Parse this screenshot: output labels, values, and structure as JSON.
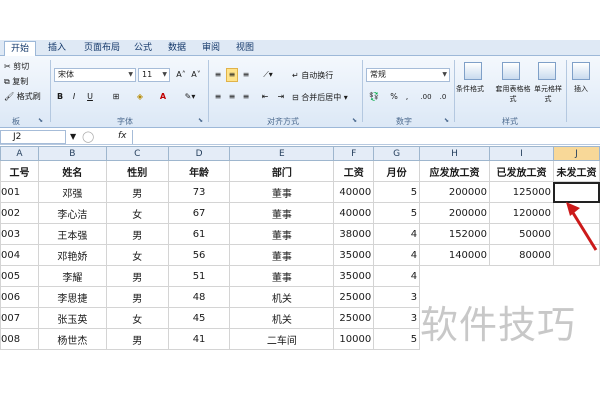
{
  "ribbon": {
    "tabs": [
      "开始",
      "插入",
      "页面布局",
      "公式",
      "数据",
      "审阅",
      "视图"
    ],
    "clipboard": {
      "cut": "剪切",
      "copy": "复制",
      "format_painter": "格式刷",
      "label": "板"
    },
    "font": {
      "name": "宋体",
      "size": "11",
      "grow": "A˄",
      "shrink": "A˅",
      "bold": "B",
      "italic": "I",
      "underline": "U",
      "label": "字体"
    },
    "alignment": {
      "wrap": "自动换行",
      "merge": "合并后居中",
      "label": "对齐方式"
    },
    "number": {
      "format": "常规",
      "label": "数字"
    },
    "styles": {
      "conditional": "条件格式",
      "as_table": "套用表格格式",
      "cell_styles": "单元格样式",
      "label": "样式"
    },
    "cells": {
      "insert": "插入"
    }
  },
  "formula_bar": {
    "name_box": "J2",
    "fx": "fx"
  },
  "columns": [
    "A",
    "B",
    "C",
    "D",
    "E",
    "F",
    "G",
    "H",
    "I",
    "J"
  ],
  "headers": [
    "工号",
    "姓名",
    "性别",
    "年龄",
    "部门",
    "工资",
    "月份",
    "应发放工资",
    "已发放工资",
    "未发工资"
  ],
  "rows": [
    [
      "001",
      "邓强",
      "男",
      "73",
      "董事",
      "40000",
      "5",
      "200000",
      "125000",
      ""
    ],
    [
      "002",
      "李心洁",
      "女",
      "67",
      "董事",
      "40000",
      "5",
      "200000",
      "120000",
      ""
    ],
    [
      "003",
      "王本强",
      "男",
      "61",
      "董事",
      "38000",
      "4",
      "152000",
      "50000",
      ""
    ],
    [
      "004",
      "邓艳娇",
      "女",
      "56",
      "董事",
      "35000",
      "4",
      "140000",
      "80000",
      ""
    ],
    [
      "005",
      "李耀",
      "男",
      "51",
      "董事",
      "35000",
      "4",
      "",
      "",
      ""
    ],
    [
      "006",
      "李思捷",
      "男",
      "48",
      "机关",
      "25000",
      "3",
      "",
      "",
      ""
    ],
    [
      "007",
      "张玉英",
      "女",
      "45",
      "机关",
      "25000",
      "3",
      "",
      "",
      ""
    ],
    [
      "008",
      "杨世杰",
      "男",
      "41",
      "二车间",
      "10000",
      "5",
      "",
      "",
      ""
    ]
  ],
  "watermark": "软件技巧",
  "colors": {
    "ribbon": "#dce8f6",
    "selection_header": "#f8d898",
    "arrow": "#cc1a1a"
  }
}
